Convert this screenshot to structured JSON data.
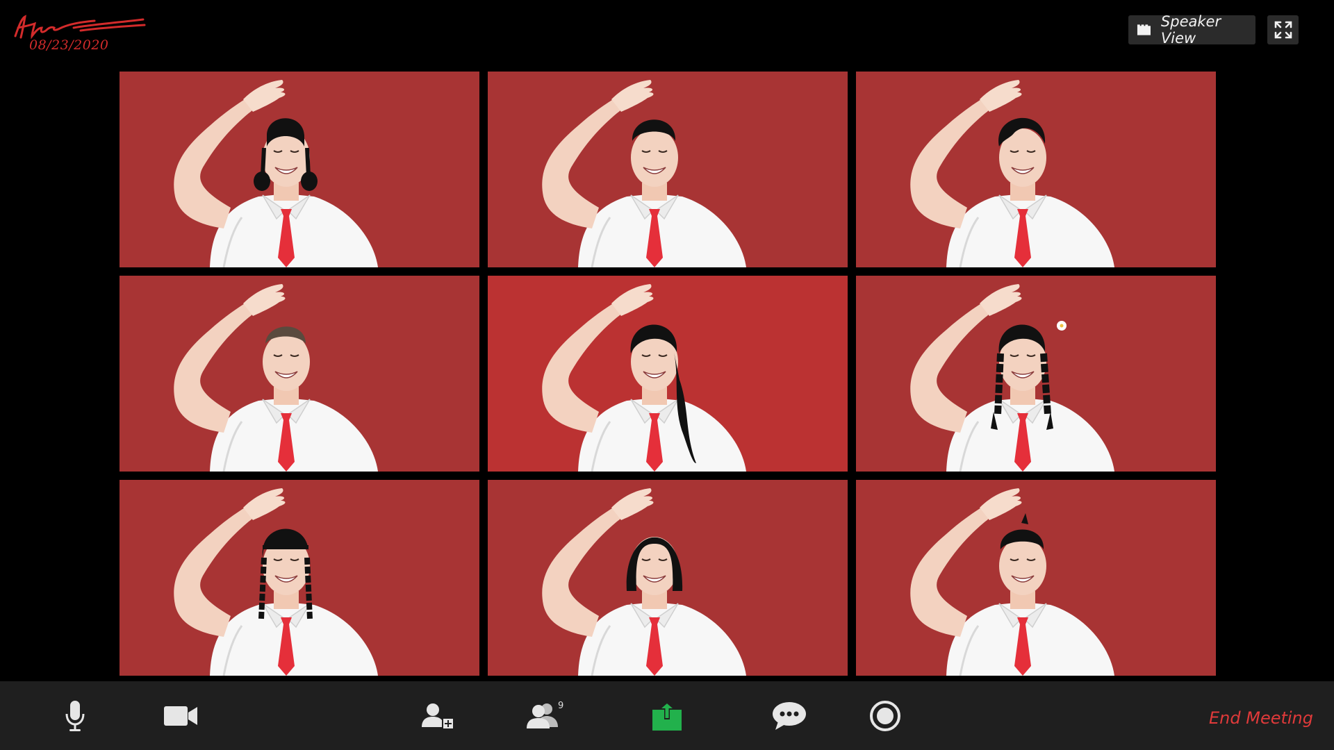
{
  "signature": {
    "date": "08/23/2020",
    "artist": "Hande"
  },
  "top_controls": {
    "speaker_view_label": "Speaker View",
    "speaker_view_icon": "grid-icon",
    "fullscreen_icon": "fullscreen-icon"
  },
  "tiles": [
    {
      "hair": "two-buns"
    },
    {
      "hair": "short"
    },
    {
      "hair": "side-part"
    },
    {
      "hair": "buzz"
    },
    {
      "hair": "ponytail"
    },
    {
      "hair": "braids-flower"
    },
    {
      "hair": "bangs-braids"
    },
    {
      "hair": "bob"
    },
    {
      "hair": "spiky"
    }
  ],
  "toolbar": {
    "items": [
      {
        "icon": "microphone-icon"
      },
      {
        "icon": "video-camera-icon"
      },
      {
        "icon": "invite-icon"
      },
      {
        "icon": "participants-icon"
      },
      {
        "icon": "share-screen-icon"
      },
      {
        "icon": "chat-icon"
      },
      {
        "icon": "record-icon"
      }
    ],
    "participants_count": "9",
    "end_meeting_label": "End Meeting"
  },
  "colors": {
    "tile_background": "#a83434",
    "tile_background_active": "#bb3232",
    "share_green": "#22b14c",
    "end_meeting_red": "#e03a3a",
    "toolbar_bg": "#1f1f1f"
  }
}
